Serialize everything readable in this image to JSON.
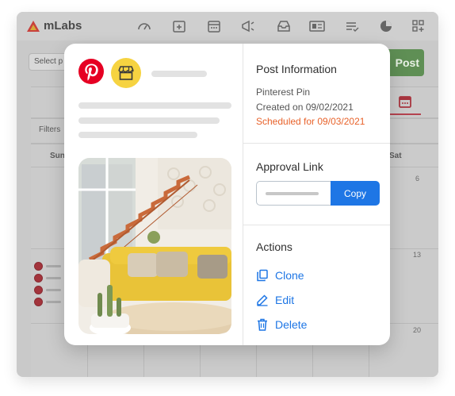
{
  "app": {
    "brand": "mLabs",
    "toolbar_icons": [
      "dashboard-icon",
      "calendar-add-icon",
      "calendar-icon",
      "megaphone-icon",
      "inbox-icon",
      "report-icon",
      "approval-icon",
      "pie-chart-icon",
      "apps-add-icon"
    ],
    "select_profile_placeholder": "Select p",
    "post_button": "Post",
    "filters_label": "Filters",
    "day_headers": {
      "first": "Sun",
      "last": "Sat"
    },
    "dates": [
      "6",
      "13",
      "20"
    ]
  },
  "modal": {
    "post_info": {
      "title": "Post Information",
      "type": "Pinterest Pin",
      "created": "Created on 09/02/2021",
      "scheduled": "Scheduled for 09/03/2021"
    },
    "approval": {
      "title": "Approval Link",
      "copy_label": "Copy"
    },
    "actions": {
      "title": "Actions",
      "items": [
        {
          "label": "Clone",
          "icon": "clone-icon"
        },
        {
          "label": "Edit",
          "icon": "edit-icon"
        },
        {
          "label": "Delete",
          "icon": "trash-icon"
        }
      ]
    }
  },
  "colors": {
    "accent": "#1e76e5",
    "scheduled": "#e8622a",
    "pinterest": "#e60023",
    "store_badge": "#f6d341",
    "post_button": "#5f8f55"
  }
}
